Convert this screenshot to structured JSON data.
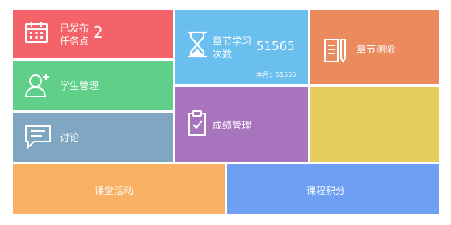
{
  "colors": {
    "red": "#f4636a",
    "blue": "#6bbfef",
    "orange": "#eb8a5c",
    "green": "#5fcf8a",
    "slate": "#7fa7c2",
    "purple": "#a874be",
    "yellow": "#e6cd5e",
    "peach": "#f7b064",
    "cornflower": "#6f9ff2"
  },
  "tiles": {
    "published_tasks": {
      "label_line1": "已发布",
      "label_line2": "任务点",
      "count": "2",
      "icon": "calendar-icon"
    },
    "chapter_study": {
      "label_line1": "章节学习",
      "label_line2": "次数",
      "count": "51565",
      "monthly": "本月：51565",
      "icon": "hourglass-icon"
    },
    "chapter_quiz": {
      "label": "章节测验",
      "icon": "document-icon"
    },
    "student_mgmt": {
      "label": "学生管理",
      "icon": "add-user-icon"
    },
    "discussion": {
      "label": "讨论",
      "icon": "chat-icon"
    },
    "grade_mgmt": {
      "label": "成绩管理",
      "icon": "clipboard-check-icon"
    },
    "class_activity": {
      "label": "课堂活动"
    },
    "course_points": {
      "label": "课程积分"
    }
  }
}
